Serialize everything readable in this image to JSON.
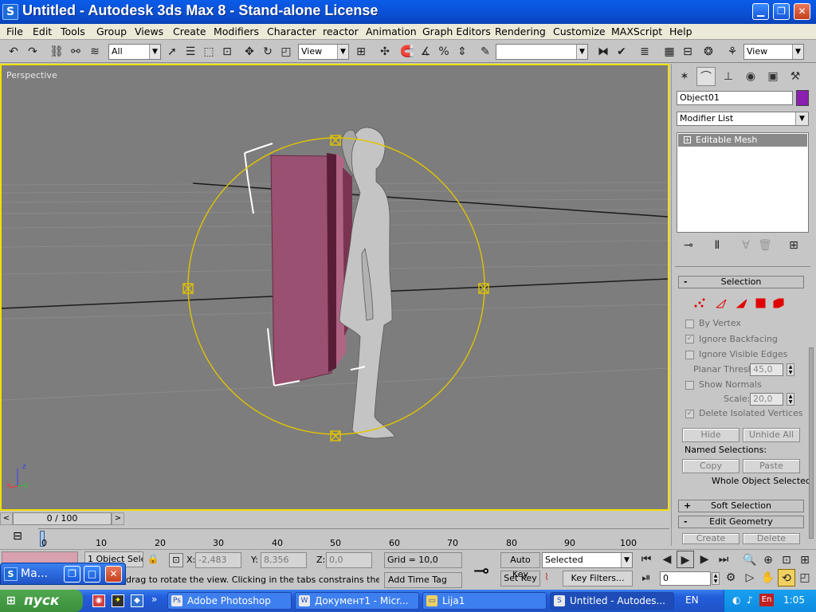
{
  "window": {
    "title": "Untitled - Autodesk 3ds Max 8  - Stand-alone License",
    "app_icon": "3ds-max-icon",
    "controls": [
      "minimize",
      "maximize",
      "close"
    ]
  },
  "menu": [
    "File",
    "Edit",
    "Tools",
    "Group",
    "Views",
    "Create",
    "Modifiers",
    "Character",
    "reactor",
    "Animation",
    "Graph Editors",
    "Rendering",
    "Customize",
    "MAXScript",
    "Help"
  ],
  "toolbar": {
    "selection_filter": "All",
    "ref_coord_system": "View",
    "named_selection_set": "",
    "render_type": "View"
  },
  "viewport": {
    "label": "Perspective",
    "axis_z": "z",
    "axis_x": "x",
    "axis_y": "y"
  },
  "command_panel": {
    "object_name": "Object01",
    "object_color": "#8a1fb0",
    "modifier_list": "Modifier List",
    "stack_item": "Editable Mesh",
    "selection": {
      "title": "Selection",
      "by_vertex": "By Vertex",
      "ignore_backfacing": "Ignore Backfacing",
      "ignore_visible_edges": "Ignore Visible Edges",
      "planar_thresh_label": "Planar Thresh:",
      "planar_thresh_value": "45,0",
      "show_normals": "Show Normals",
      "scale_label": "Scale:",
      "scale_value": "20,0",
      "delete_isolated": "Delete Isolated Vertices",
      "hide": "Hide",
      "unhide_all": "Unhide All",
      "named_selections": "Named Selections:",
      "copy": "Copy",
      "paste": "Paste",
      "status": "Whole Object Selected"
    },
    "soft_selection": "Soft Selection",
    "edit_geometry": "Edit Geometry",
    "create": "Create",
    "delete": "Delete"
  },
  "timeline": {
    "slider_label": "0 / 100",
    "ticks": [
      "0",
      "10",
      "20",
      "30",
      "40",
      "50",
      "60",
      "70",
      "80",
      "90",
      "100"
    ]
  },
  "status": {
    "selection_count": "1 Object Sele",
    "prompt": "drag to rotate the view.  Clicking in the tabs constrains the rotation",
    "x_label": "X:",
    "x_value": "-2,483",
    "y_label": "Y:",
    "y_value": "8,356",
    "z_label": "Z:",
    "z_value": "0,0",
    "grid": "Grid = 10,0",
    "add_time_tag": "Add Time Tag",
    "auto_key": "Auto Key",
    "set_key": "Set Key",
    "selected": "Selected",
    "key_filters": "Key Filters...",
    "frame": "0"
  },
  "minimized_window": {
    "title": "Ma..."
  },
  "taskbar": {
    "start": "пуск",
    "tasks": [
      {
        "label": "Adobe Photoshop",
        "icon": "photoshop-icon"
      },
      {
        "label": "Документ1 - Micr...",
        "icon": "word-icon"
      },
      {
        "label": "Lija1",
        "icon": "folder-icon"
      },
      {
        "label": "Untitled - Autodes...",
        "icon": "3ds-max-icon"
      }
    ],
    "language": "EN",
    "tray_lang": "En",
    "clock": "1:05"
  }
}
